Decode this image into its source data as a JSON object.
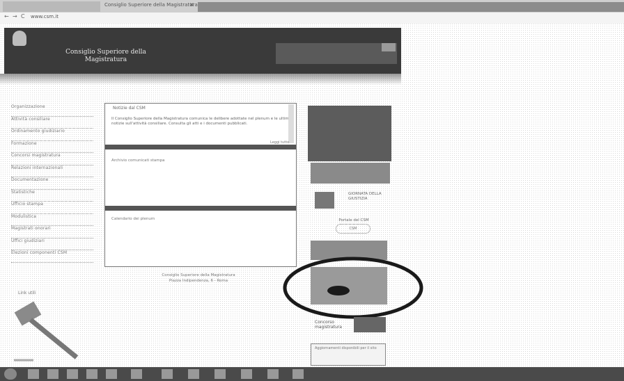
{
  "browser": {
    "tab_title": "Consiglio Superiore della Magistratura",
    "tab_close": "×",
    "address": "www.csm.it",
    "nav_back": "←",
    "nav_forward": "→",
    "nav_reload": "C"
  },
  "site": {
    "title_line1": "Consiglio Superiore della",
    "title_line2": "Magistratura"
  },
  "left_nav": {
    "items": [
      "Organizzazione",
      "Attività consiliare",
      "Ordinamento giudiziario",
      "Formazione",
      "Concorsi magistratura",
      "Relazioni internazionali",
      "Documentazione",
      "Statistiche",
      "Ufficio stampa",
      "Modulistica",
      "Magistrati onorari",
      "Uffici giudiziari",
      "Elezioni componenti CSM"
    ],
    "caption": "Link utili"
  },
  "content": {
    "news_title": "Notizie dal CSM",
    "news_text": "Il Consiglio Superiore della Magistratura comunica le delibere adottate nel plenum e le ultime notizie sull'attività consiliare. Consulta gli atti e i documenti pubblicati.",
    "news_more": "Leggi tutto",
    "section_link_1": "Archivio comunicati stampa",
    "section_link_2": "Calendario dei plenum"
  },
  "footer": {
    "line1": "Consiglio Superiore della Magistratura",
    "line2": "Piazza Indipendenza, 6 - Roma"
  },
  "right_column": {
    "banner3_text": "GIORNATA DELLA GIUSTIZIA",
    "banner4_text": "Portale del CSM",
    "banner4_logo": "CSM",
    "banner7_text": "Concorso magistratura",
    "popup_text": "Aggiornamenti disponibili per il sito"
  },
  "colors": {
    "header_bg": "#3a3a3a",
    "ring": "#1a1a1a"
  }
}
